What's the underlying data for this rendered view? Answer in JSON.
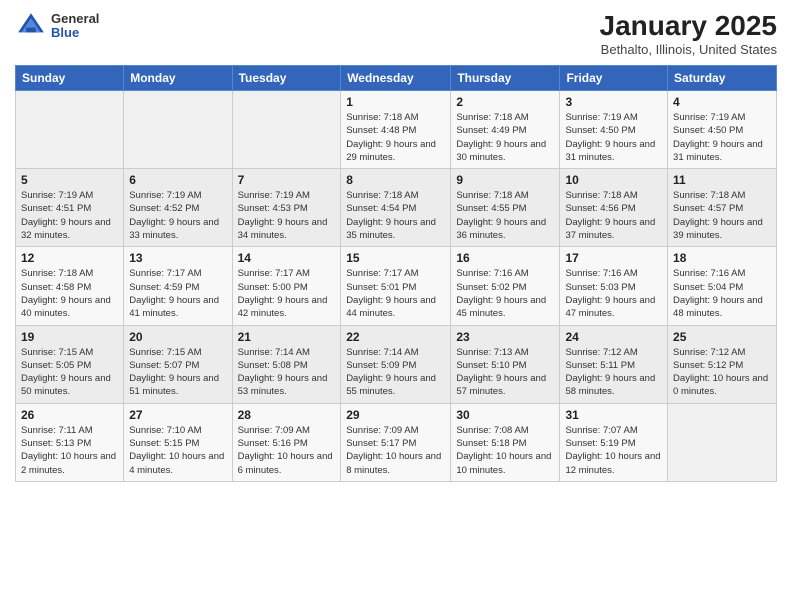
{
  "logo": {
    "general": "General",
    "blue": "Blue"
  },
  "title": "January 2025",
  "subtitle": "Bethalto, Illinois, United States",
  "days_header": [
    "Sunday",
    "Monday",
    "Tuesday",
    "Wednesday",
    "Thursday",
    "Friday",
    "Saturday"
  ],
  "weeks": [
    [
      {
        "day": "",
        "info": ""
      },
      {
        "day": "",
        "info": ""
      },
      {
        "day": "",
        "info": ""
      },
      {
        "day": "1",
        "info": "Sunrise: 7:18 AM\nSunset: 4:48 PM\nDaylight: 9 hours\nand 29 minutes."
      },
      {
        "day": "2",
        "info": "Sunrise: 7:18 AM\nSunset: 4:49 PM\nDaylight: 9 hours\nand 30 minutes."
      },
      {
        "day": "3",
        "info": "Sunrise: 7:19 AM\nSunset: 4:50 PM\nDaylight: 9 hours\nand 31 minutes."
      },
      {
        "day": "4",
        "info": "Sunrise: 7:19 AM\nSunset: 4:50 PM\nDaylight: 9 hours\nand 31 minutes."
      }
    ],
    [
      {
        "day": "5",
        "info": "Sunrise: 7:19 AM\nSunset: 4:51 PM\nDaylight: 9 hours\nand 32 minutes."
      },
      {
        "day": "6",
        "info": "Sunrise: 7:19 AM\nSunset: 4:52 PM\nDaylight: 9 hours\nand 33 minutes."
      },
      {
        "day": "7",
        "info": "Sunrise: 7:19 AM\nSunset: 4:53 PM\nDaylight: 9 hours\nand 34 minutes."
      },
      {
        "day": "8",
        "info": "Sunrise: 7:18 AM\nSunset: 4:54 PM\nDaylight: 9 hours\nand 35 minutes."
      },
      {
        "day": "9",
        "info": "Sunrise: 7:18 AM\nSunset: 4:55 PM\nDaylight: 9 hours\nand 36 minutes."
      },
      {
        "day": "10",
        "info": "Sunrise: 7:18 AM\nSunset: 4:56 PM\nDaylight: 9 hours\nand 37 minutes."
      },
      {
        "day": "11",
        "info": "Sunrise: 7:18 AM\nSunset: 4:57 PM\nDaylight: 9 hours\nand 39 minutes."
      }
    ],
    [
      {
        "day": "12",
        "info": "Sunrise: 7:18 AM\nSunset: 4:58 PM\nDaylight: 9 hours\nand 40 minutes."
      },
      {
        "day": "13",
        "info": "Sunrise: 7:17 AM\nSunset: 4:59 PM\nDaylight: 9 hours\nand 41 minutes."
      },
      {
        "day": "14",
        "info": "Sunrise: 7:17 AM\nSunset: 5:00 PM\nDaylight: 9 hours\nand 42 minutes."
      },
      {
        "day": "15",
        "info": "Sunrise: 7:17 AM\nSunset: 5:01 PM\nDaylight: 9 hours\nand 44 minutes."
      },
      {
        "day": "16",
        "info": "Sunrise: 7:16 AM\nSunset: 5:02 PM\nDaylight: 9 hours\nand 45 minutes."
      },
      {
        "day": "17",
        "info": "Sunrise: 7:16 AM\nSunset: 5:03 PM\nDaylight: 9 hours\nand 47 minutes."
      },
      {
        "day": "18",
        "info": "Sunrise: 7:16 AM\nSunset: 5:04 PM\nDaylight: 9 hours\nand 48 minutes."
      }
    ],
    [
      {
        "day": "19",
        "info": "Sunrise: 7:15 AM\nSunset: 5:05 PM\nDaylight: 9 hours\nand 50 minutes."
      },
      {
        "day": "20",
        "info": "Sunrise: 7:15 AM\nSunset: 5:07 PM\nDaylight: 9 hours\nand 51 minutes."
      },
      {
        "day": "21",
        "info": "Sunrise: 7:14 AM\nSunset: 5:08 PM\nDaylight: 9 hours\nand 53 minutes."
      },
      {
        "day": "22",
        "info": "Sunrise: 7:14 AM\nSunset: 5:09 PM\nDaylight: 9 hours\nand 55 minutes."
      },
      {
        "day": "23",
        "info": "Sunrise: 7:13 AM\nSunset: 5:10 PM\nDaylight: 9 hours\nand 57 minutes."
      },
      {
        "day": "24",
        "info": "Sunrise: 7:12 AM\nSunset: 5:11 PM\nDaylight: 9 hours\nand 58 minutes."
      },
      {
        "day": "25",
        "info": "Sunrise: 7:12 AM\nSunset: 5:12 PM\nDaylight: 10 hours\nand 0 minutes."
      }
    ],
    [
      {
        "day": "26",
        "info": "Sunrise: 7:11 AM\nSunset: 5:13 PM\nDaylight: 10 hours\nand 2 minutes."
      },
      {
        "day": "27",
        "info": "Sunrise: 7:10 AM\nSunset: 5:15 PM\nDaylight: 10 hours\nand 4 minutes."
      },
      {
        "day": "28",
        "info": "Sunrise: 7:09 AM\nSunset: 5:16 PM\nDaylight: 10 hours\nand 6 minutes."
      },
      {
        "day": "29",
        "info": "Sunrise: 7:09 AM\nSunset: 5:17 PM\nDaylight: 10 hours\nand 8 minutes."
      },
      {
        "day": "30",
        "info": "Sunrise: 7:08 AM\nSunset: 5:18 PM\nDaylight: 10 hours\nand 10 minutes."
      },
      {
        "day": "31",
        "info": "Sunrise: 7:07 AM\nSunset: 5:19 PM\nDaylight: 10 hours\nand 12 minutes."
      },
      {
        "day": "",
        "info": ""
      }
    ]
  ]
}
